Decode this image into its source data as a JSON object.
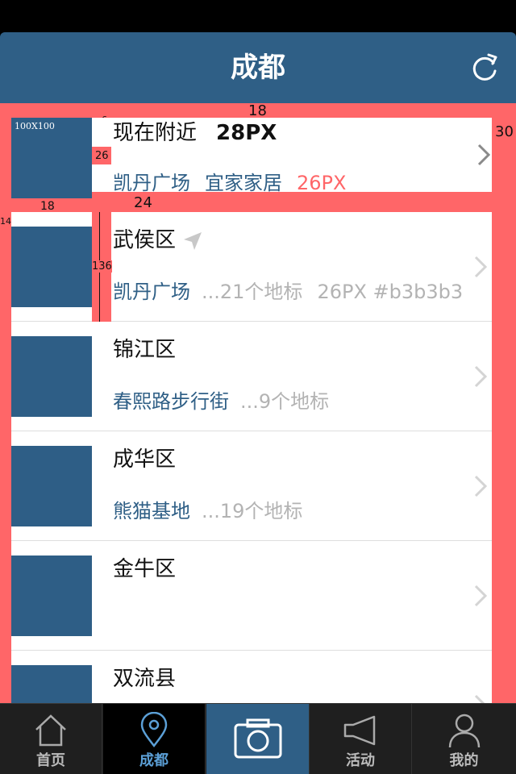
{
  "app_title": "成都",
  "header": {
    "refresh_icon": "refresh-icon"
  },
  "annotations": {
    "thumb_size": "100X100",
    "gap_6": "6",
    "gap_18_top": "18",
    "gap_30": "30",
    "gap_26": "26",
    "gap_18_bottom": "18",
    "gap_24": "24",
    "gap_14": "14",
    "height_136": "136"
  },
  "rows": [
    {
      "title": "现在附近",
      "title_note": "28PX",
      "sub_main": "凯丹广场",
      "sub_extra": "宜家家居",
      "sub_note": "26PX"
    },
    {
      "title": "武侯区",
      "has_location_icon": true,
      "sub_main": "凯丹广场",
      "sub_extra": "...21个地标",
      "sub_note": "26PX #b3b3b3"
    },
    {
      "title": "锦江区",
      "sub_main": "春熙路步行街",
      "sub_extra": "...9个地标"
    },
    {
      "title": "成华区",
      "sub_main": "熊猫基地",
      "sub_extra": "...19个地标"
    },
    {
      "title": "金牛区",
      "sub_main": "",
      "sub_extra": ""
    },
    {
      "title": "双流县",
      "sub_main": "",
      "sub_extra": ""
    }
  ],
  "colors": {
    "nav_bg": "#2f5f86",
    "thumb": "#2e5e86",
    "annotation_red": "#ff6668",
    "sub_gray": "#b3b3b3",
    "active_tab": "#5b9fd6"
  },
  "tabs": [
    {
      "label": "首页",
      "icon": "home-icon"
    },
    {
      "label": "成都",
      "icon": "location-pin-icon",
      "active": true
    },
    {
      "label": "",
      "icon": "camera-icon"
    },
    {
      "label": "活动",
      "icon": "megaphone-icon"
    },
    {
      "label": "我的",
      "icon": "user-icon"
    }
  ]
}
